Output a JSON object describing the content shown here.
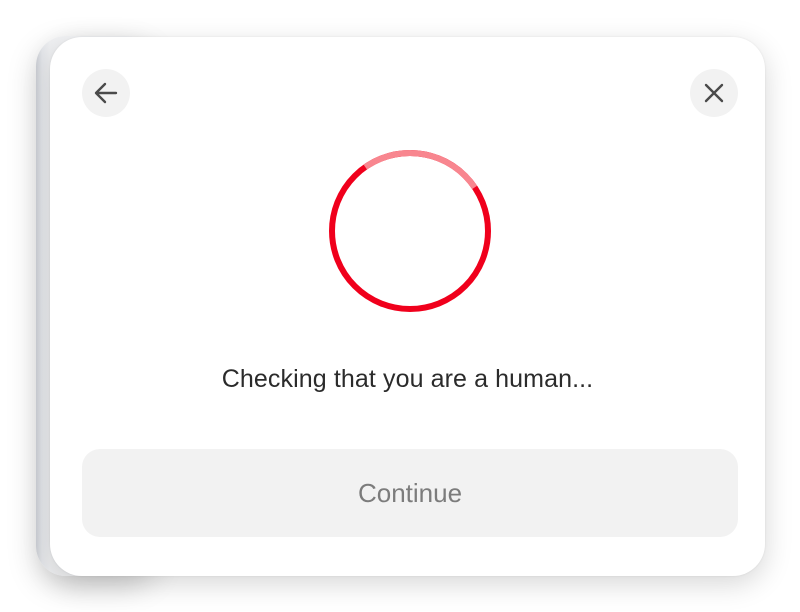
{
  "dialog": {
    "status_text": "Checking that you are a human...",
    "continue_label": "Continue",
    "continue_enabled": false
  },
  "icons": {
    "back": "arrow-left-icon",
    "close": "close-icon",
    "spinner": "loading-spinner-icon"
  },
  "colors": {
    "spinner_primary": "#f0001c",
    "spinner_faded": "#f8868f",
    "button_bg": "#f2f2f2",
    "button_text_disabled": "#7c7c7c",
    "text": "#2b2b2b"
  }
}
